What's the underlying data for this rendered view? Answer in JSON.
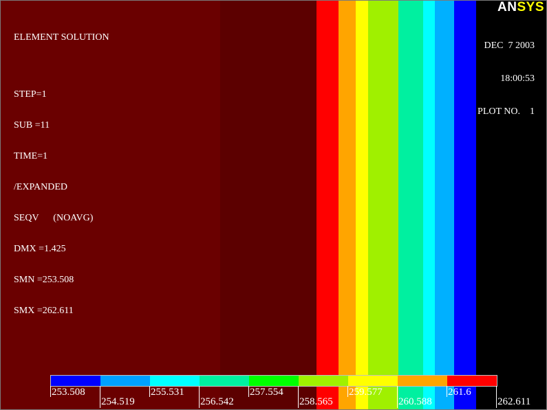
{
  "header": {
    "title": "ELEMENT SOLUTION",
    "lines": [
      "STEP=1",
      "SUB =11",
      "TIME=1",
      "/EXPANDED",
      "SEQV      (NOAVG)",
      "DMX =1.425",
      "SMN =253.508",
      "SMX =262.611"
    ]
  },
  "logo": {
    "an": "AN",
    "sys": "SYS"
  },
  "date": {
    "date": "DEC  7 2003",
    "time": "18:00:53",
    "plot": "PLOT NO.    1"
  },
  "contour": {
    "bands": [
      {
        "color": "#6a0000",
        "from": 0.0,
        "to": 0.403
      },
      {
        "color": "#5c0000",
        "from": 0.403,
        "to": 0.578
      },
      {
        "color": "#ff0000",
        "from": 0.578,
        "to": 0.619
      },
      {
        "color": "#ffa500",
        "from": 0.619,
        "to": 0.65
      },
      {
        "color": "#ffff00",
        "from": 0.65,
        "to": 0.673
      },
      {
        "color": "#a0f000",
        "from": 0.673,
        "to": 0.728
      },
      {
        "color": "#00f0a0",
        "from": 0.728,
        "to": 0.774
      },
      {
        "color": "#00ffff",
        "from": 0.774,
        "to": 0.795
      },
      {
        "color": "#00b0ff",
        "from": 0.795,
        "to": 0.83
      },
      {
        "color": "#0000ff",
        "from": 0.83,
        "to": 0.87
      },
      {
        "color": "#000000",
        "from": 0.87,
        "to": 1.0
      }
    ]
  },
  "legend": {
    "colors": [
      "#0000ff",
      "#00a0ff",
      "#00ffff",
      "#00f0a0",
      "#00ff00",
      "#a0f000",
      "#ffff00",
      "#ffa500",
      "#ff0000"
    ],
    "labels": [
      "253.508",
      "254.519",
      "255.531",
      "256.542",
      "257.554",
      "258.565",
      "259.577",
      "260.588",
      "261.6",
      "262.611"
    ]
  }
}
